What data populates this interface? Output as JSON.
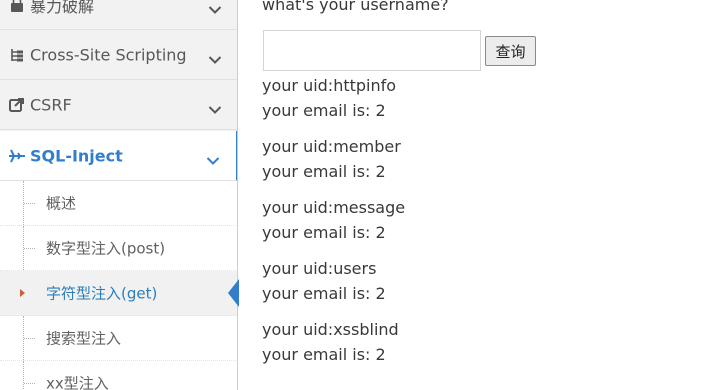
{
  "sidebar": {
    "items": [
      {
        "label": "暴力破解",
        "icon": "lock-icon"
      },
      {
        "label": "Cross-Site Scripting",
        "icon": "list-tree-icon"
      },
      {
        "label": "CSRF",
        "icon": "share-icon"
      },
      {
        "label": "SQL-Inject",
        "icon": "plane-icon"
      }
    ],
    "sub_items": [
      {
        "label": "概述"
      },
      {
        "label": "数字型注入(post)"
      },
      {
        "label": "字符型注入(get)"
      },
      {
        "label": "搜索型注入"
      },
      {
        "label": "xx型注入"
      }
    ]
  },
  "form": {
    "question": "what's your username?",
    "input_value": "",
    "button_label": "查询"
  },
  "results": [
    {
      "uid": "your uid:httpinfo",
      "email": "your email is: 2"
    },
    {
      "uid": "your uid:member",
      "email": "your email is: 2"
    },
    {
      "uid": "your uid:message",
      "email": "your email is: 2"
    },
    {
      "uid": "your uid:users",
      "email": "your email is: 2"
    },
    {
      "uid": "your uid:xssblind",
      "email": "your email is: 2"
    }
  ],
  "colors": {
    "accent": "#307ecc",
    "active_caret": "#c86139"
  }
}
